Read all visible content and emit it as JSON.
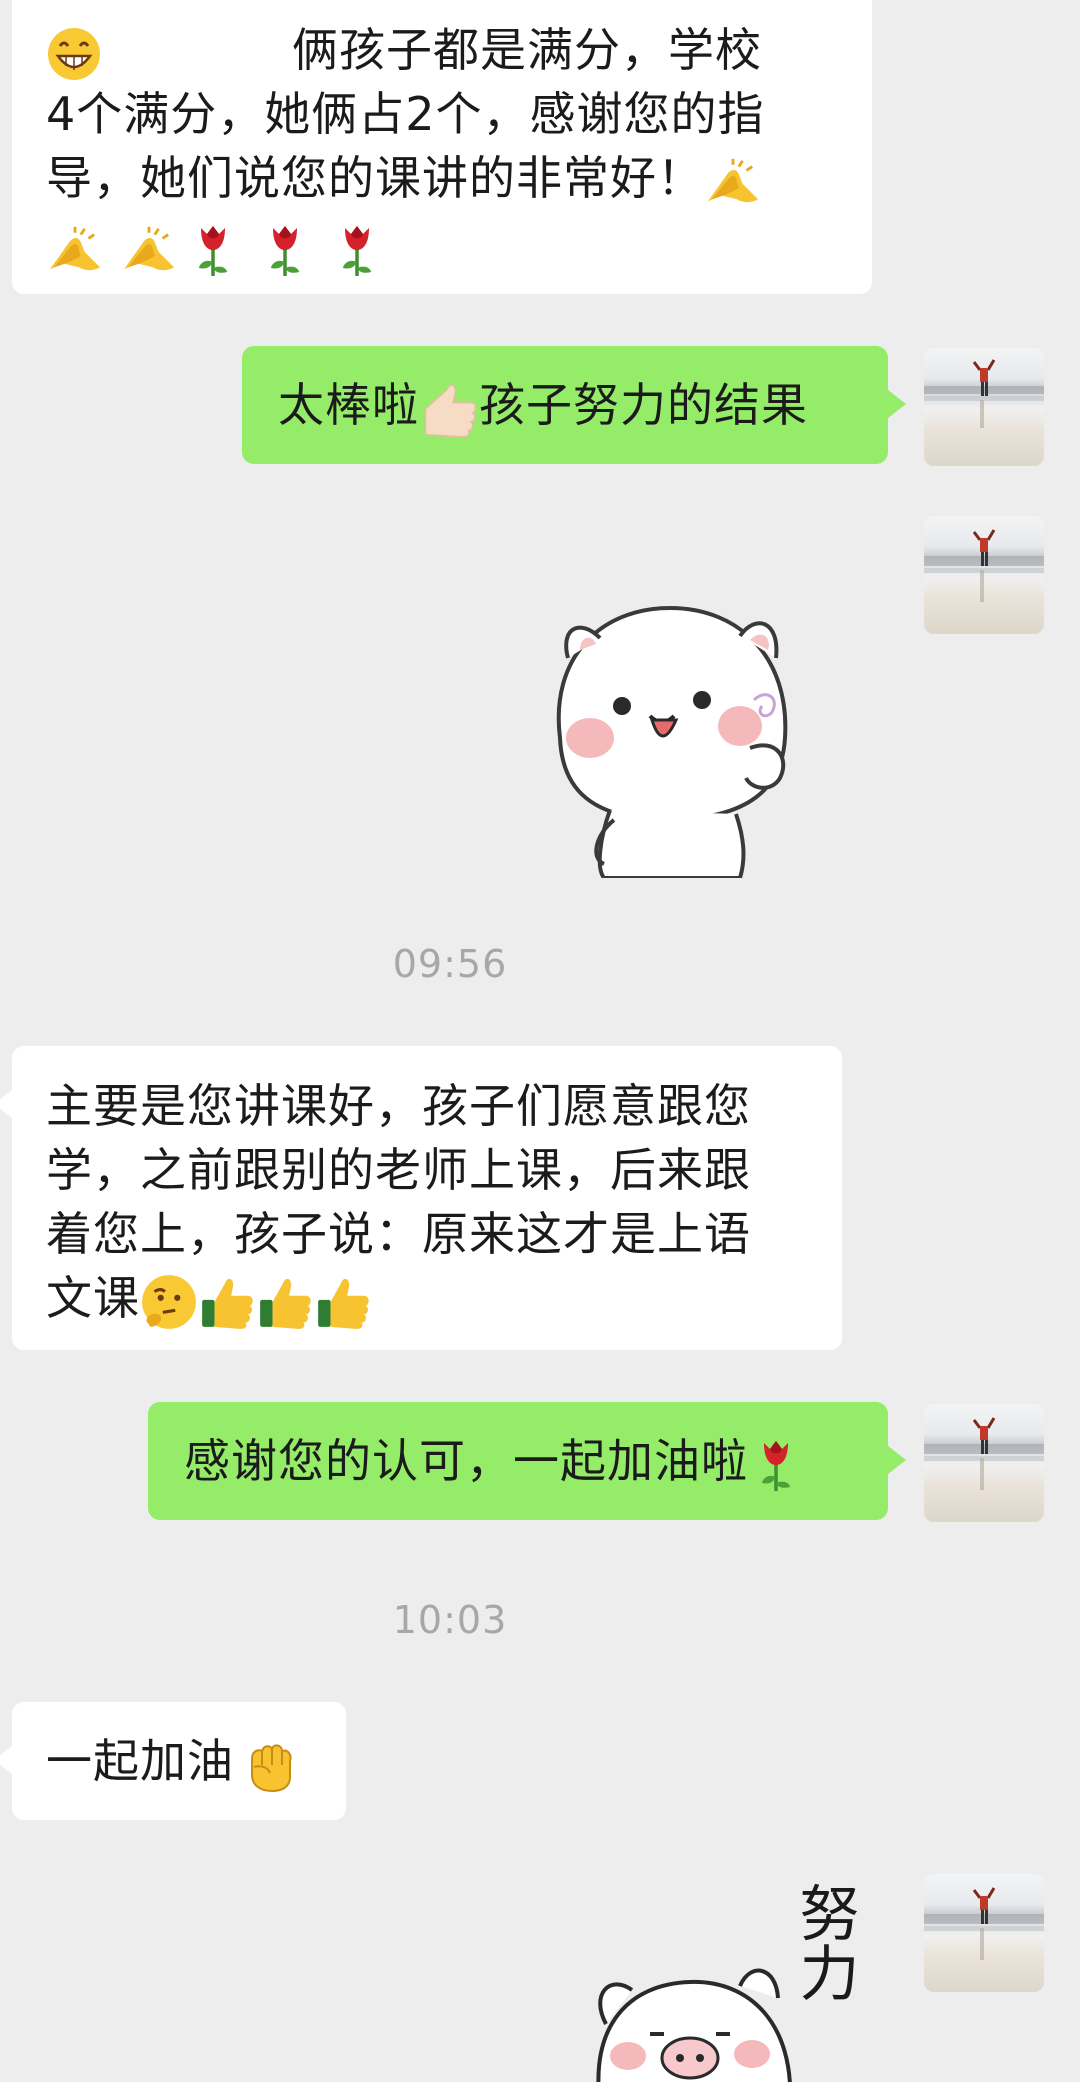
{
  "messages": {
    "m1": {
      "lines": [
        "俩孩子都是满分，学校",
        "4个满分，她俩占2个，感谢您的指",
        "导，她们说您的课讲的非常好！"
      ]
    },
    "m2": {
      "text_a": "太棒啦",
      "text_b": "孩子努力的结果"
    },
    "m3": {
      "lines": [
        "主要是您讲课好，孩子们愿意跟您",
        "学，之前跟别的老师上课，后来跟",
        "着您上，孩子说：原来这才是上语",
        "文课"
      ]
    },
    "m4": {
      "text": "感谢您的认可，一起加油啦"
    },
    "m5": {
      "text": "一起加油"
    }
  },
  "timestamps": {
    "t1": "09:56",
    "t2": "10:03"
  },
  "stickers": {
    "effort_text": "努力"
  },
  "icons": {
    "grin": "grinning-face-icon",
    "pray": "praying-hands-icon",
    "rose": "rose-icon",
    "thumb": "thumbs-up-icon",
    "thinking": "thinking-face-icon",
    "fist": "raised-fist-icon"
  },
  "colors": {
    "background": "#ededed",
    "incoming": "#ffffff",
    "outgoing": "#95ec69"
  }
}
